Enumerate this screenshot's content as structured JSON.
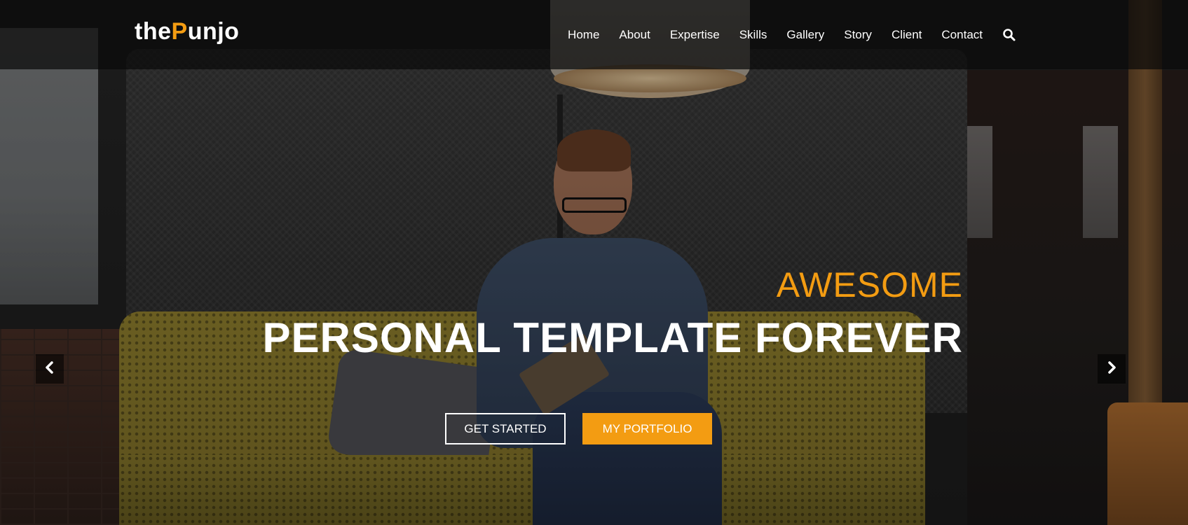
{
  "brand": {
    "prefix": "the",
    "accent": "P",
    "rest": "unjo",
    "accent_color": "#f39c12"
  },
  "nav": {
    "items": [
      {
        "label": "Home"
      },
      {
        "label": "About"
      },
      {
        "label": "Expertise"
      },
      {
        "label": "Skills"
      },
      {
        "label": "Gallery"
      },
      {
        "label": "Story"
      },
      {
        "label": "Client"
      },
      {
        "label": "Contact"
      }
    ],
    "search_icon": "search-icon"
  },
  "hero": {
    "subtitle": "AWESOME",
    "title": "PERSONAL TEMPLATE FOREVER",
    "buttons": {
      "get_started": "GET STARTED",
      "portfolio": "MY PORTFOLIO"
    },
    "arrows": {
      "prev_icon": "chevron-left-icon",
      "next_icon": "chevron-right-icon"
    }
  },
  "colors": {
    "accent": "#f39c12",
    "text": "#ffffff",
    "nav_bg": "#0a0a0a"
  }
}
